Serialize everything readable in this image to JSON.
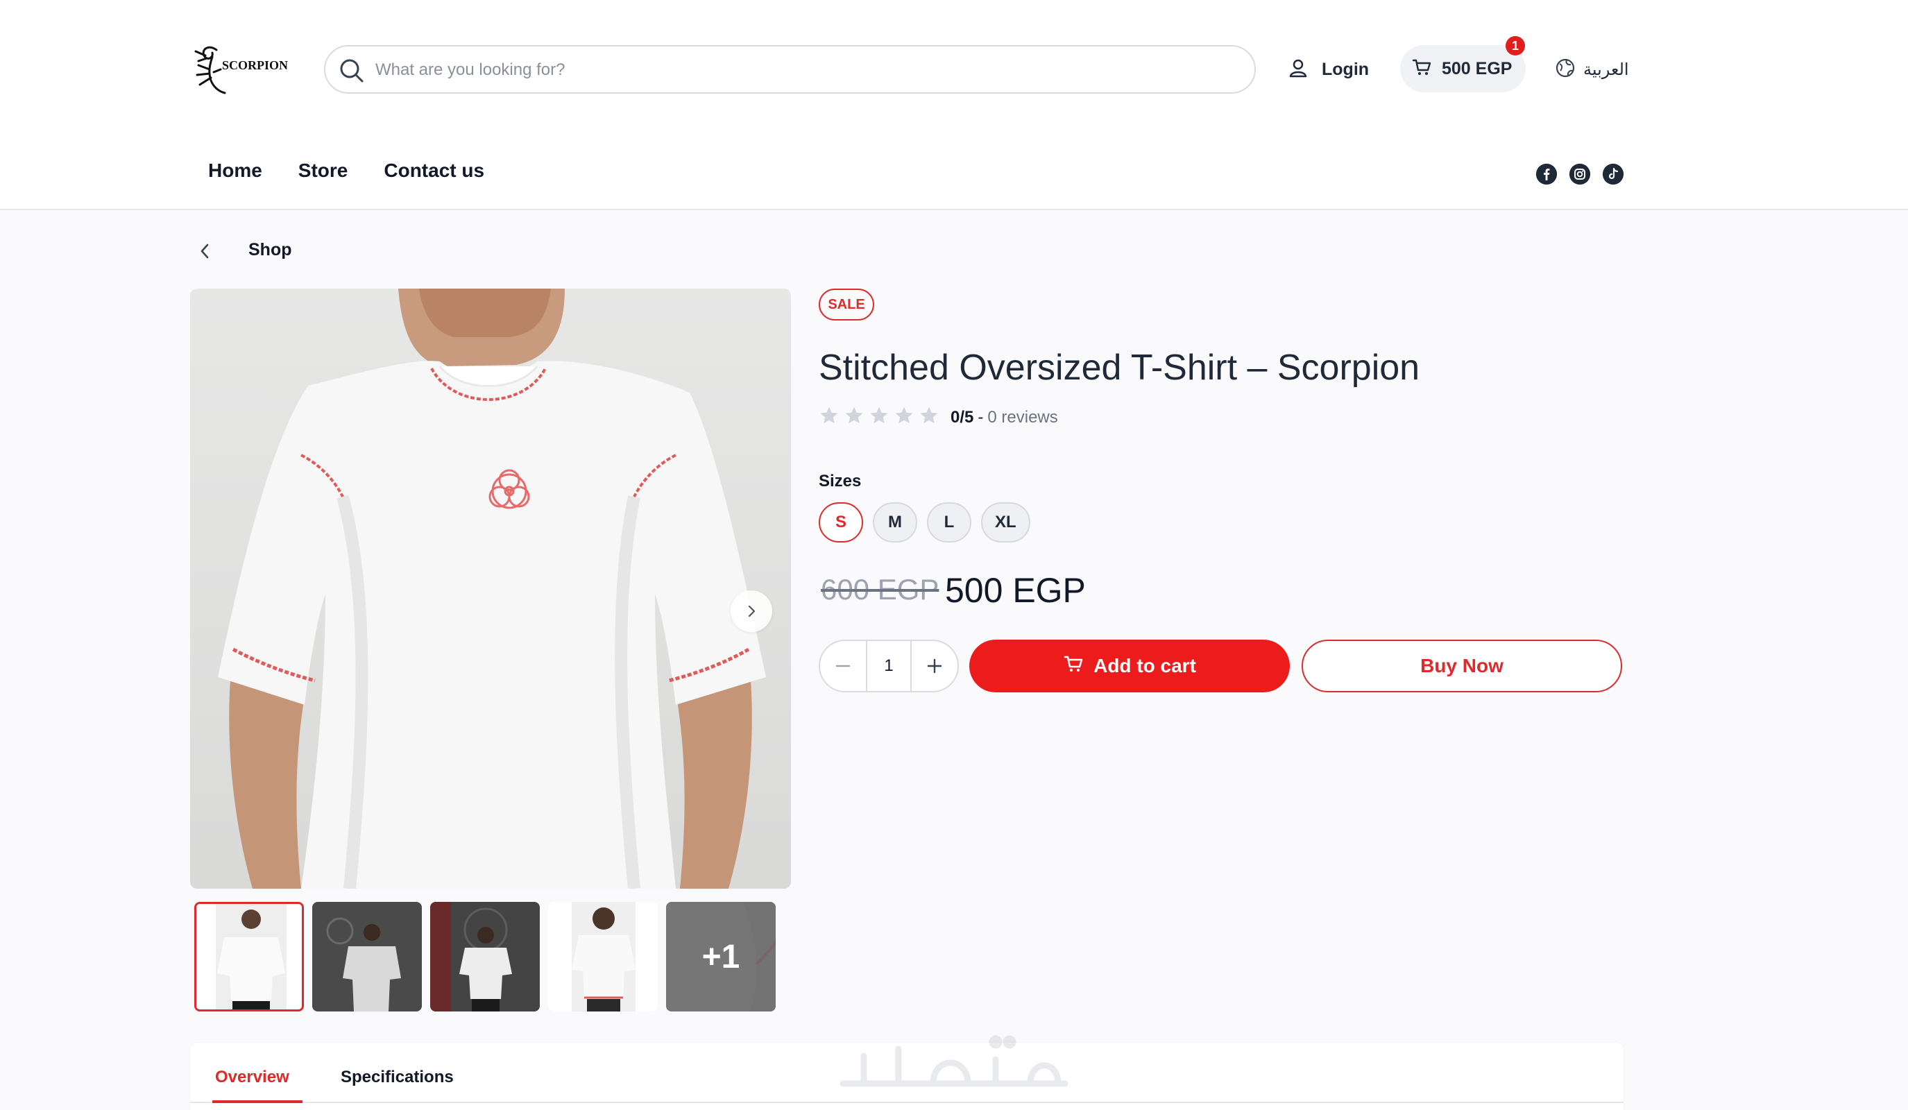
{
  "brand": {
    "logo_text": "SCORPION"
  },
  "header": {
    "search": {
      "placeholder": "What are you looking for?",
      "value": ""
    },
    "login_label": "Login",
    "cart_total": "500 EGP",
    "cart_count": "1",
    "language_label": "العربية"
  },
  "nav": {
    "items": [
      {
        "label": "Home"
      },
      {
        "label": "Store"
      },
      {
        "label": "Contact us"
      }
    ]
  },
  "socials": [
    "facebook-icon",
    "instagram-icon",
    "tiktok-icon"
  ],
  "breadcrumb": {
    "current": "Shop"
  },
  "product": {
    "badge": "SALE",
    "title": "Stitched Oversized T-Shirt – Scorpion",
    "rating": {
      "score_text": "0/5",
      "separator": "-",
      "reviews_text": "0 reviews",
      "stars_filled": 0,
      "stars_total": 5
    },
    "sizes_label": "Sizes",
    "sizes": [
      {
        "label": "S",
        "selected": true
      },
      {
        "label": "M",
        "selected": false
      },
      {
        "label": "L",
        "selected": false
      },
      {
        "label": "XL",
        "selected": false
      }
    ],
    "old_price": "600 EGP",
    "price": "500 EGP",
    "quantity": "1",
    "add_to_cart_label": "Add to cart",
    "buy_now_label": "Buy Now",
    "gallery": {
      "more_count_label": "+1",
      "active_index": 0
    }
  },
  "tabs": [
    {
      "label": "Overview",
      "active": true
    },
    {
      "label": "Specifications",
      "active": false
    }
  ],
  "colors": {
    "accent": "#ED1C1C",
    "accent_border": "#DD2B2B",
    "badge": "#E01E1E",
    "text_dark": "#1F2937"
  }
}
